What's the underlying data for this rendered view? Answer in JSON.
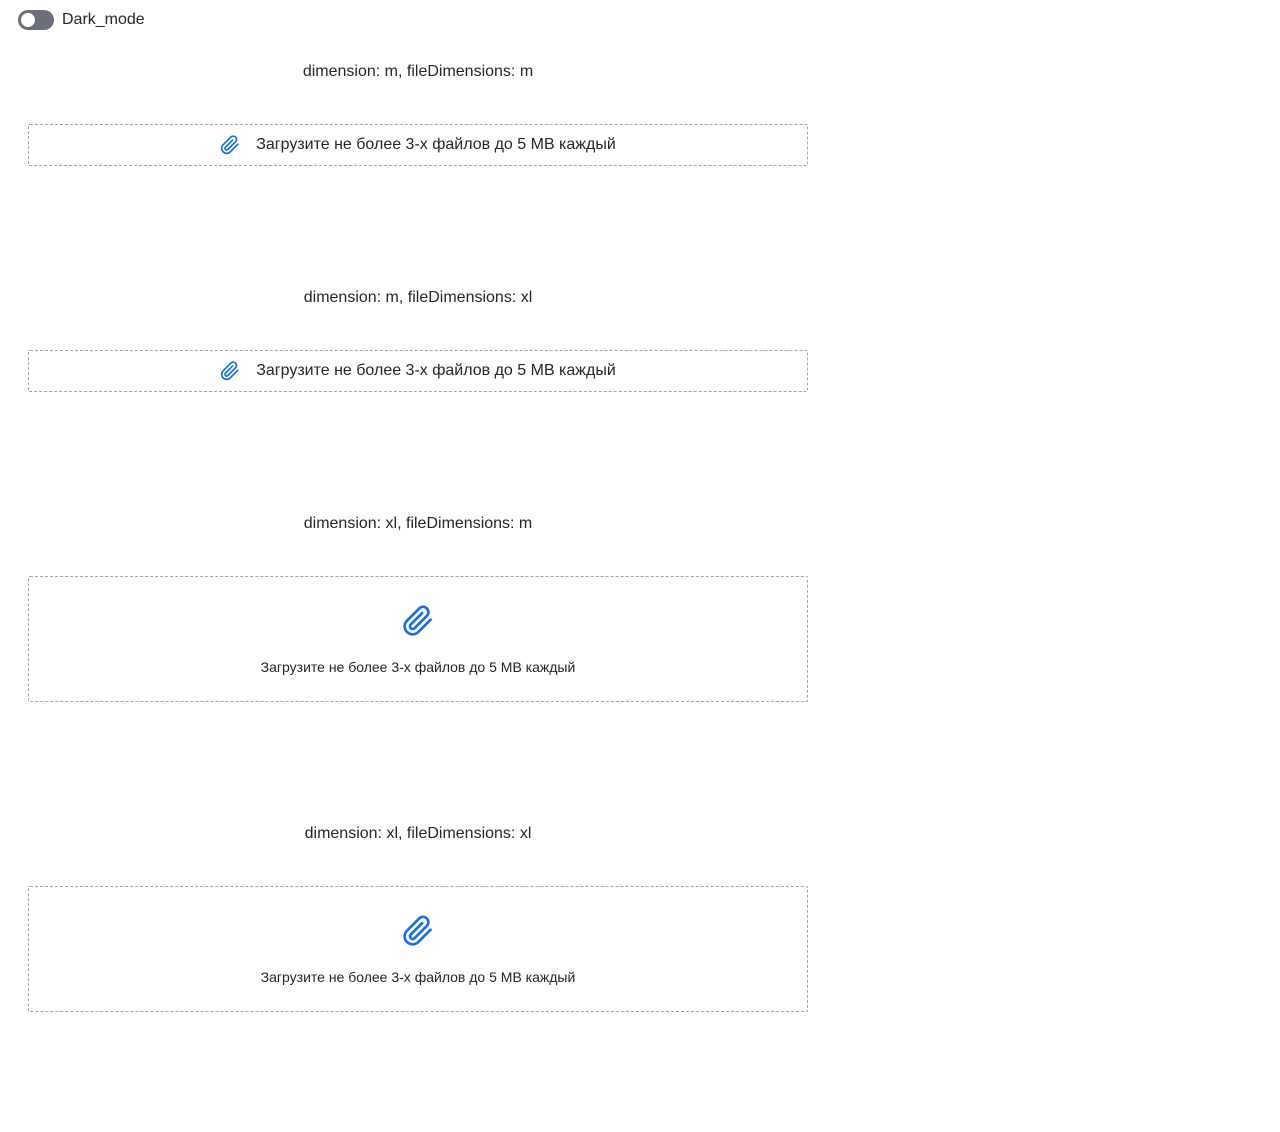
{
  "dark_mode_toggle": {
    "label": "Dark_mode",
    "state": "off"
  },
  "sections": [
    {
      "title": "dimension: m, fileDimensions: m",
      "dropzone_text": "Загрузите не более 3-х файлов до 5 MB каждый",
      "icon": "paperclip-icon"
    },
    {
      "title": "dimension: m, fileDimensions: xl",
      "dropzone_text": "Загрузите не более 3-х файлов до 5 MB каждый",
      "icon": "paperclip-icon"
    },
    {
      "title": "dimension: xl, fileDimensions: m",
      "dropzone_text": "Загрузите не более 3-х файлов до 5 MB каждый",
      "icon": "paperclip-icon"
    },
    {
      "title": "dimension: xl, fileDimensions: xl",
      "dropzone_text": "Загрузите не более 3-х файлов до 5 MB каждый",
      "icon": "paperclip-icon"
    }
  ],
  "colors": {
    "accent": "#1a6ed8",
    "text": "#23262b",
    "toggle_off": "#6b6f7a",
    "border": "#9ea3ab"
  }
}
